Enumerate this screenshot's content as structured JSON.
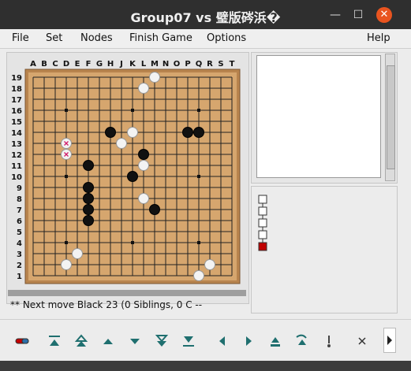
{
  "window": {
    "title": "Group07 vs 璧版硶浜�"
  },
  "menubar": {
    "items": [
      "File",
      "Set",
      "Nodes",
      "Finish Game",
      "Options",
      "Help"
    ]
  },
  "board": {
    "size": 19,
    "columns": [
      "A",
      "B",
      "C",
      "D",
      "E",
      "F",
      "G",
      "H",
      "J",
      "K",
      "L",
      "M",
      "N",
      "O",
      "P",
      "Q",
      "R",
      "S",
      "T"
    ],
    "rows": [
      "19",
      "18",
      "17",
      "16",
      "15",
      "14",
      "13",
      "12",
      "11",
      "10",
      "9",
      "8",
      "7",
      "6",
      "5",
      "4",
      "3",
      "2",
      "1"
    ],
    "board_color": "#d6a66e",
    "frame_color": "#b8844e",
    "stones": {
      "black": [
        "H14",
        "P14",
        "Q14",
        "L12",
        "F11",
        "K10",
        "F9",
        "F8",
        "F7",
        "M7",
        "F6"
      ],
      "white": [
        "M19",
        "L18",
        "K14",
        "J13",
        "D13",
        "D12",
        "L11",
        "L8",
        "E3",
        "D2",
        "R2",
        "Q1"
      ]
    },
    "marked": [
      "D13",
      "D12"
    ]
  },
  "status": {
    "text": "** Next move  Black 23 (0 Siblings, 0 C --"
  },
  "tree": {
    "node_count": 5,
    "current_color": "#c00000"
  },
  "toolbar": {
    "buttons": [
      "new-game",
      "first-move",
      "back-10",
      "back",
      "forward",
      "forward-10",
      "last-move",
      "prev-variation",
      "next-variation",
      "main-line",
      "goto-branch",
      "mark",
      "pass",
      "more"
    ]
  }
}
